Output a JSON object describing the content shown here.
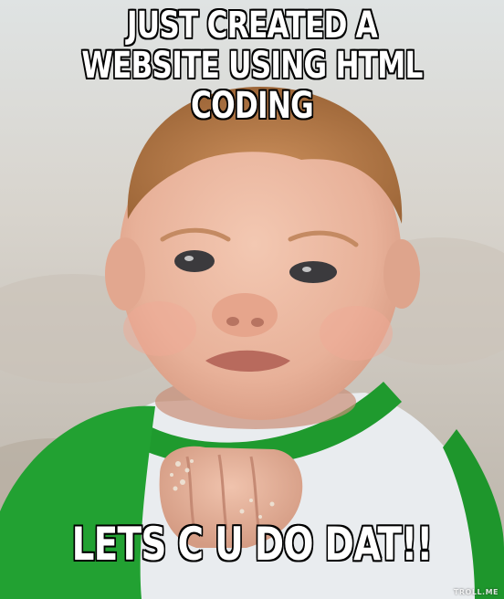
{
  "meme": {
    "top_text": "JUST CREATED A WEBSITE USING HTML CODING",
    "bottom_text": "LETS C U DO DAT!!",
    "watermark": "TROLL.ME",
    "photo_subject": "success-kid-baby-fist"
  },
  "colors": {
    "caption_fill": "#ffffff",
    "caption_outline": "#000000",
    "shirt_green": "#1f9a2e",
    "shirt_white": "#e9ecef",
    "skin": "#e8b79e",
    "hair": "#b97a4a",
    "sand": "#cdc7bf"
  }
}
